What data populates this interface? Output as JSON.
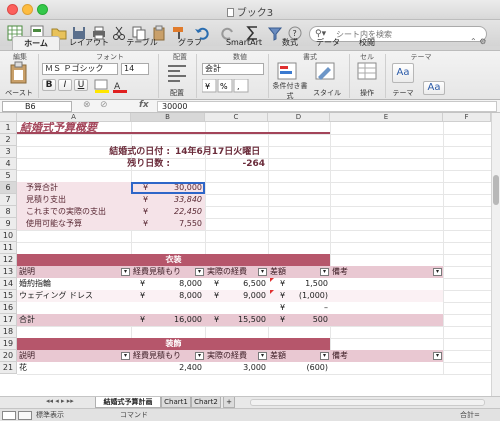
{
  "window": {
    "title": "ブック3"
  },
  "search": {
    "placeholder": "シート内を検索"
  },
  "ribbon_tabs": [
    "ホーム",
    "レイアウト",
    "テーブル",
    "グラフ",
    "SmartArt",
    "数式",
    "データ",
    "校閲"
  ],
  "ribbon": {
    "group_edit": "編集",
    "group_font": "フォント",
    "group_align": "配置",
    "group_number": "数値",
    "group_format": "書式",
    "group_cells": "セル",
    "group_theme": "テーマ",
    "paste": "ペースト",
    "font_name": "ＭＳ Ｐゴシック",
    "font_size": "14",
    "number_format": "会計",
    "align_label": "配置",
    "cond_format": "条件付き書式",
    "style": "スタイル",
    "ops": "操作",
    "theme": "テーマ",
    "bold": "B",
    "italic": "I",
    "underline": "U",
    "theme_sample": "Aa"
  },
  "formula_bar": {
    "cell_ref": "B6",
    "fx": "fx",
    "value": "30000"
  },
  "columns": [
    "A",
    "B",
    "C",
    "D",
    "E",
    "F"
  ],
  "rows": [
    "1",
    "2",
    "3",
    "4",
    "5",
    "6",
    "7",
    "8",
    "9",
    "10",
    "11",
    "12",
    "13",
    "14",
    "15",
    "16",
    "17",
    "18",
    "19",
    "20",
    "21"
  ],
  "sheet": {
    "title": "結婚式予算概要",
    "date_label": "結婚式の日付 :",
    "date_value": "14年6月17日火曜日",
    "days_label": "残り日数 :",
    "days_value": "-264",
    "summary": [
      {
        "label": "予算合計",
        "yen": "¥",
        "value": "30,000",
        "italic": false
      },
      {
        "label": "見積り支出",
        "yen": "¥",
        "value": "33,840",
        "italic": true
      },
      {
        "label": "これまでの実際の支出",
        "yen": "¥",
        "value": "22,450",
        "italic": true
      },
      {
        "label": "使用可能な予算",
        "yen": "¥",
        "value": "7,550",
        "italic": false
      }
    ],
    "section1": {
      "title": "衣装",
      "headers": [
        "説明",
        "経費見積もり",
        "実際の経費",
        "差額",
        "備考"
      ],
      "items": [
        {
          "desc": "婚約指輪",
          "est": "8,000",
          "act": "6,500",
          "diff": "1,500"
        },
        {
          "desc": "ウェディング ドレス",
          "est": "8,000",
          "act": "9,000",
          "diff": "(1,000)"
        },
        {
          "desc": "",
          "est": "",
          "act": "",
          "diff": "–"
        }
      ],
      "total_label": "合計",
      "total_est": "16,000",
      "total_act": "15,500",
      "total_diff": "500",
      "yen": "¥"
    },
    "section2": {
      "title": "装飾",
      "headers": [
        "説明",
        "経費見積もり",
        "実際の経費",
        "差額",
        "備考"
      ],
      "row21": {
        "desc": "花",
        "est": "2,400",
        "act": "3,000",
        "diff": "(600)"
      }
    }
  },
  "sheet_tabs": [
    "結婚式予算計画",
    "Chart1",
    "Chart2",
    "+"
  ],
  "status": {
    "mode": "標準表示",
    "ready": "コマンド",
    "sum": "合計="
  },
  "colors": {
    "accent_dark": "#a3455a",
    "accent_light": "#f5e3e8",
    "header_band": "#e9c8d2",
    "title_band": "#b6566b"
  }
}
